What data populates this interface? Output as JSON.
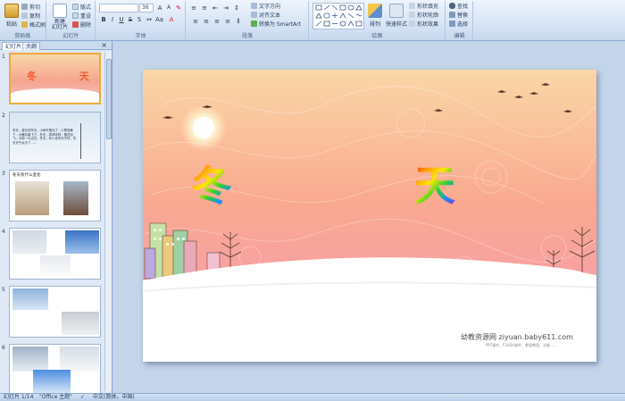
{
  "ribbon": {
    "clipboard": {
      "label": "剪贴板",
      "paste": "粘贴",
      "cut": "剪切",
      "copy": "复制",
      "painter": "格式刷"
    },
    "slides": {
      "label": "幻灯片",
      "new_slide": "新建\n幻灯片",
      "layout": "版式",
      "reset": "重设",
      "delete": "删除"
    },
    "font": {
      "label": "字体",
      "size": "36"
    },
    "paragraph": {
      "label": "段落",
      "text_direction": "文字方向",
      "align_text": "对齐文本",
      "smartart": "转换为 SmartArt"
    },
    "drawing": {
      "label": "绘图",
      "arrange": "排列",
      "quick_styles": "快速样式",
      "shape_fill": "形状填充",
      "shape_outline": "形状轮廓",
      "shape_effects": "形状效果"
    },
    "editing": {
      "label": "编辑",
      "find": "查找",
      "replace": "替换",
      "select": "选择"
    }
  },
  "panel": {
    "tab_slides": "幻灯片",
    "tab_outline": "大纲",
    "close": "×",
    "thumbs": [
      {
        "num": "1",
        "title": "冬  天"
      },
      {
        "num": "2",
        "text": "冬天，漫长的冬天，小树叶落光了，小草变黄了，大雁向南飞了。冬天，寒风呼呼，雪花纷飞，大地一片洁白。冬天，有人说冬天不好，冬天天气太冷了……"
      },
      {
        "num": "3",
        "text": "冬天有什么变化"
      },
      {
        "num": "4"
      },
      {
        "num": "5"
      },
      {
        "num": "6"
      }
    ]
  },
  "slide": {
    "title_left": "冬",
    "title_right": "天",
    "watermark": "幼教资源网 ziyuan.baby611.com",
    "watermark_sub": "PPT课件、FLASH课件、教案教案、试卷……"
  },
  "status": {
    "slide_num": "幻灯片 1/14",
    "theme": "\"Office 主题\"",
    "language": "中文(简体，中国)"
  },
  "colors": {
    "accent": "#f0a93c",
    "ribbon_text": "#1e395b"
  }
}
